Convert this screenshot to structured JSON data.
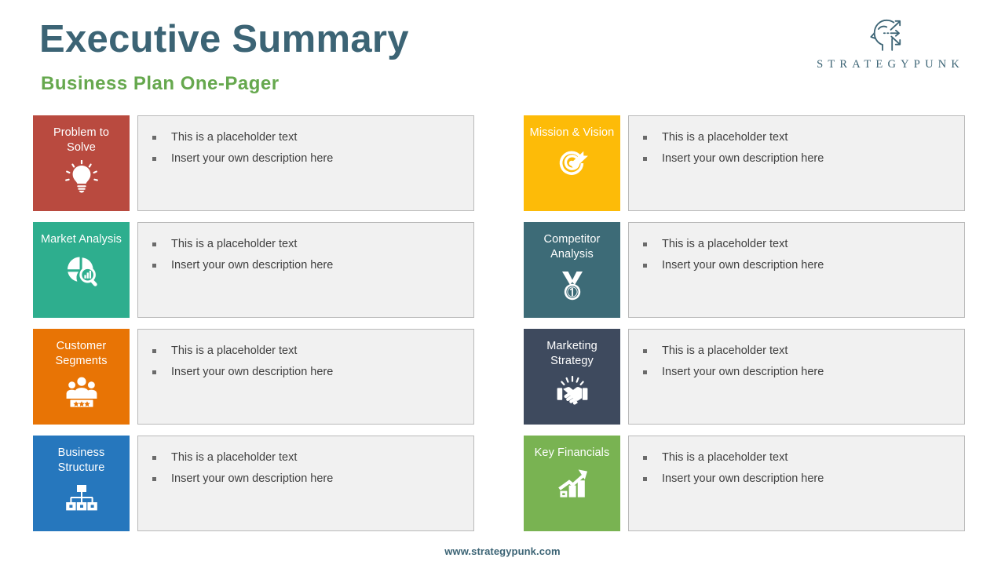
{
  "header": {
    "title": "Executive Summary",
    "subtitle": "Business Plan One-Pager",
    "title_color": "#3c6475",
    "subtitle_color": "#66a84e",
    "brand_name": "STRATEGYPUNK",
    "brand_icon": "head-arrows-icon"
  },
  "footer": {
    "url": "www.strategypunk.com"
  },
  "bullets": {
    "line1": "This is a placeholder text",
    "line2": "Insert your own description here"
  },
  "cards": [
    {
      "id": "problem-to-solve",
      "label": "Problem to Solve",
      "color": "#b94a3f",
      "icon": "lightbulb-icon",
      "column": "left",
      "row": 1,
      "bullets": [
        "This is a placeholder text",
        "Insert your own description here"
      ]
    },
    {
      "id": "market-analysis",
      "label": "Market Analysis",
      "color": "#2eae8e",
      "icon": "pie-chart-magnifier-icon",
      "column": "left",
      "row": 2,
      "bullets": [
        "This is a placeholder text",
        "Insert your own description here"
      ]
    },
    {
      "id": "customer-segments",
      "label": "Customer Segments",
      "color": "#e87405",
      "icon": "people-stars-icon",
      "column": "left",
      "row": 3,
      "bullets": [
        "This is a placeholder text",
        "Insert your own description here"
      ]
    },
    {
      "id": "business-structure",
      "label": "Business Structure",
      "color": "#2677bd",
      "icon": "org-chart-icon",
      "column": "left",
      "row": 4,
      "bullets": [
        "This is a placeholder text",
        "Insert your own description here"
      ]
    },
    {
      "id": "mission-and-vision",
      "label": "Mission & Vision",
      "color": "#fdbb08",
      "icon": "target-arrow-icon",
      "column": "right",
      "row": 1,
      "bullets": [
        "This is a placeholder text",
        "Insert your own description here"
      ]
    },
    {
      "id": "competitor-analysis",
      "label": "Competitor Analysis",
      "color": "#3d6b77",
      "icon": "medal-one-icon",
      "column": "right",
      "row": 2,
      "bullets": [
        "This is a placeholder text",
        "Insert your own description here"
      ]
    },
    {
      "id": "marketing-strategy",
      "label": "Marketing Strategy",
      "color": "#3e4a5e",
      "icon": "handshake-icon",
      "column": "right",
      "row": 3,
      "bullets": [
        "This is a placeholder text",
        "Insert your own description here"
      ]
    },
    {
      "id": "key-financials",
      "label": "Key Financials",
      "color": "#79b352",
      "icon": "growth-chart-icon",
      "column": "right",
      "row": 4,
      "bullets": [
        "This is a placeholder text",
        "Insert your own description here"
      ]
    }
  ]
}
